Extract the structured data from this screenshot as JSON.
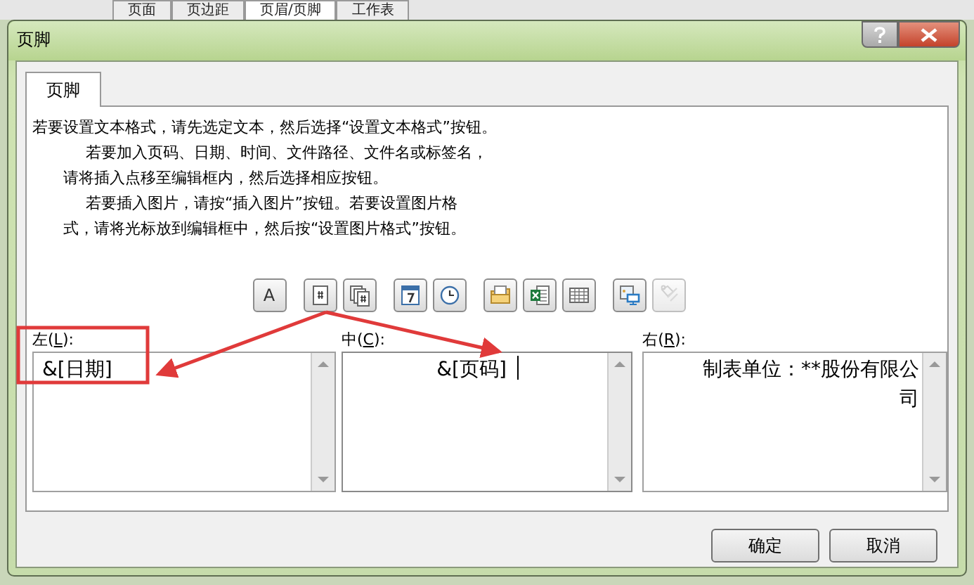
{
  "background_tabs": [
    {
      "label": "页面",
      "selected": false
    },
    {
      "label": "页边距",
      "selected": false
    },
    {
      "label": "页眉/页脚",
      "selected": true
    },
    {
      "label": "工作表",
      "selected": false
    }
  ],
  "window": {
    "title": "页脚"
  },
  "tabs": [
    {
      "label": "页脚",
      "selected": true
    }
  ],
  "instructions": [
    {
      "kind": "lead",
      "text": "若要设置文本格式，请先选定文本，然后选择“设置文本格式”按钮。"
    },
    {
      "kind": "indent",
      "text": "若要加入页码、日期、时间、文件路径、文件名或标签名，"
    },
    {
      "kind": "wrap",
      "text": "请将插入点移至编辑框内，然后选择相应按钮。"
    },
    {
      "kind": "indent",
      "text": "若要插入图片，请按“插入图片”按钮。若要设置图片格"
    },
    {
      "kind": "wrap",
      "text": "式，请将光标放到编辑框中，然后按“设置图片格式”按钮。"
    }
  ],
  "toolbar": [
    [
      {
        "kind": "format-text",
        "label": "A",
        "disabled": false
      }
    ],
    [
      {
        "kind": "page-number",
        "disabled": false
      },
      {
        "kind": "page-count",
        "disabled": false
      }
    ],
    [
      {
        "kind": "date",
        "disabled": false
      },
      {
        "kind": "time",
        "disabled": false
      }
    ],
    [
      {
        "kind": "file-path",
        "disabled": false
      },
      {
        "kind": "file-name",
        "disabled": false
      },
      {
        "kind": "sheet-name",
        "disabled": false
      }
    ],
    [
      {
        "kind": "picture",
        "disabled": false
      },
      {
        "kind": "format-picture",
        "disabled": true
      }
    ]
  ],
  "sections": [
    {
      "prefix": "左(",
      "key": "L",
      "suffix": "):",
      "value": "&[日期]",
      "focused": false
    },
    {
      "prefix": "中(",
      "key": "C",
      "suffix": "):",
      "value": "&[页码]",
      "focused": true
    },
    {
      "prefix": "右(",
      "key": "R",
      "suffix": "):",
      "value": "制表单位：**股份有限公司",
      "focused": false
    }
  ],
  "annotations": [
    {
      "kind": "highlight-box"
    },
    {
      "kind": "arrow"
    },
    {
      "kind": "arrow"
    }
  ],
  "buttons": [
    {
      "label": "确定"
    },
    {
      "label": "取消"
    }
  ]
}
